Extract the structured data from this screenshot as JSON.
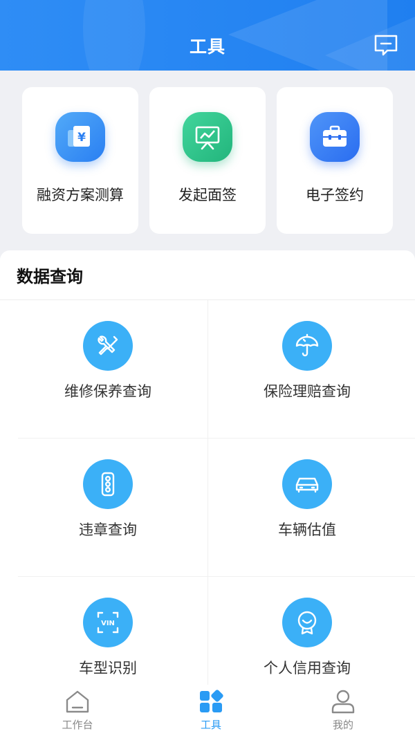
{
  "header": {
    "title": "工具"
  },
  "quick_tools": [
    {
      "label": "融资方案测算",
      "icon": "finance-calculator-icon",
      "color": "#3a8ff5"
    },
    {
      "label": "发起面签",
      "icon": "presentation-chart-icon",
      "color": "#2cc38a"
    },
    {
      "label": "电子签约",
      "icon": "briefcase-icon",
      "color": "#3a7ff5"
    }
  ],
  "data_query": {
    "title": "数据查询",
    "items": [
      {
        "label": "维修保养查询",
        "icon": "tools-icon"
      },
      {
        "label": "保险理赔查询",
        "icon": "umbrella-icon"
      },
      {
        "label": "违章查询",
        "icon": "traffic-light-icon"
      },
      {
        "label": "车辆估值",
        "icon": "car-icon"
      },
      {
        "label": "车型识别",
        "icon": "vin-scan-icon"
      },
      {
        "label": "个人信用查询",
        "icon": "credit-badge-icon"
      }
    ]
  },
  "bottom_nav": {
    "items": [
      {
        "label": "工作台",
        "icon": "home-icon",
        "active": false
      },
      {
        "label": "工具",
        "icon": "grid-icon",
        "active": true
      },
      {
        "label": "我的",
        "icon": "person-icon",
        "active": false
      }
    ]
  },
  "colors": {
    "primary": "#2a9bf4",
    "header": "#2383f1",
    "query_icon_bg": "#3bb0f7"
  }
}
